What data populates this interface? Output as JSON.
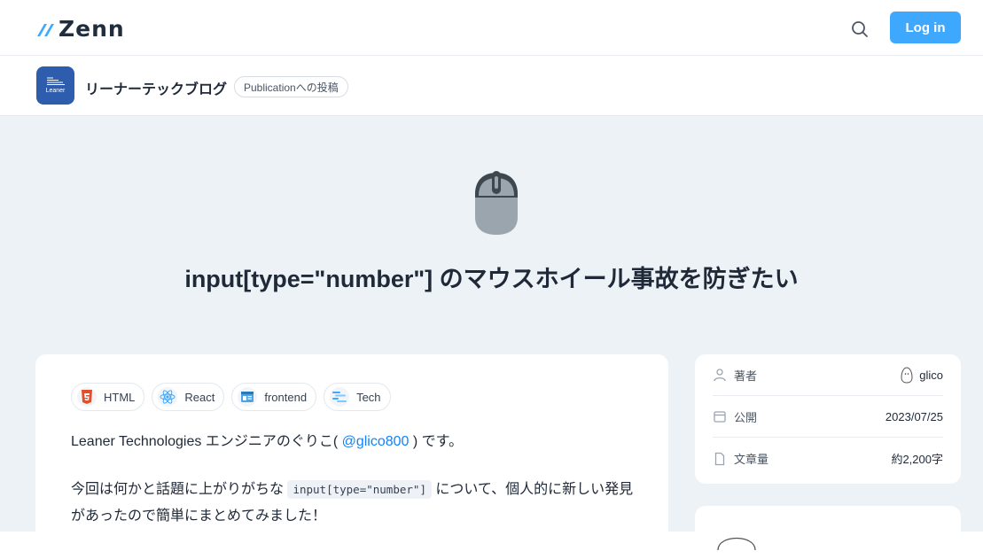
{
  "header": {
    "logo_text": "Zenn",
    "login_label": "Log in"
  },
  "publication": {
    "logo_text": "Leaner",
    "name": "リーナーテックブログ",
    "badge": "Publicationへの投稿"
  },
  "article": {
    "title": "input[type=\"number\"] のマウスホイール事故を防ぎたい",
    "topics": [
      {
        "label": "HTML",
        "icon": "html5-icon"
      },
      {
        "label": "React",
        "icon": "react-icon"
      },
      {
        "label": "frontend",
        "icon": "frontend-icon"
      },
      {
        "label": "Tech",
        "icon": "tech-icon"
      }
    ],
    "p1_before": "Leaner Technologies エンジニアのぐりこ( ",
    "p1_mention": "@glico800",
    "p1_after": " ) です。",
    "p2_before": "今回は何かと話題に上がりがちな ",
    "p2_code": "input[type=\"number\"]",
    "p2_after": " について、個人的に新しい発見があったので簡単にまとめてみました！"
  },
  "sidebar": {
    "author_label": "著者",
    "author_name": "glico",
    "published_label": "公開",
    "published_date": "2023/07/25",
    "length_label": "文章量",
    "length_value": "約2,200字"
  },
  "colors": {
    "accent": "#3ea8ff",
    "hero_bg": "#edf2f7",
    "pub_logo": "#2f5dad",
    "mention": "#0f83fd"
  }
}
